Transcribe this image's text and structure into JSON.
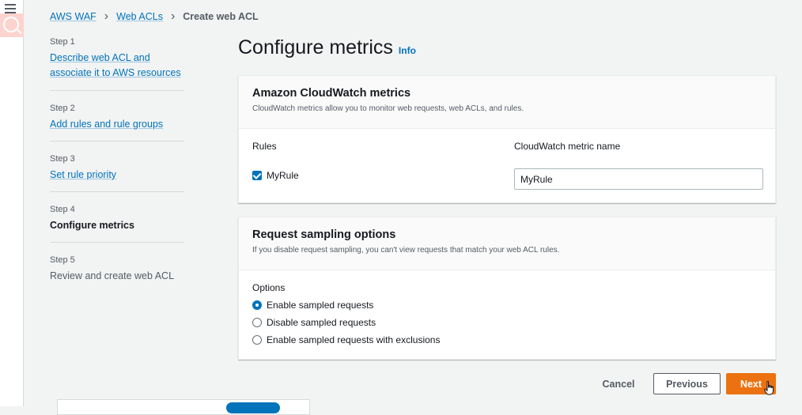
{
  "breadcrumb": {
    "items": [
      "AWS WAF",
      "Web ACLs"
    ],
    "current": "Create web ACL"
  },
  "steps": [
    {
      "label": "Step 1",
      "title_line1": "Describe web ACL and",
      "title_line2": "associate it to AWS resources",
      "state": "link"
    },
    {
      "label": "Step 2",
      "title_line1": "Add rules and rule groups",
      "state": "link"
    },
    {
      "label": "Step 3",
      "title_line1": "Set rule priority",
      "state": "link"
    },
    {
      "label": "Step 4",
      "title_line1": "Configure metrics",
      "state": "active"
    },
    {
      "label": "Step 5",
      "title_line1": "Review and create web ACL",
      "state": "disabled"
    }
  ],
  "page": {
    "title": "Configure metrics",
    "info": "Info"
  },
  "cloudwatch": {
    "title": "Amazon CloudWatch metrics",
    "description": "CloudWatch metrics allow you to monitor web requests, web ACLs, and rules.",
    "rules_header": "Rules",
    "metric_header": "CloudWatch metric name",
    "rule_name": "MyRule",
    "metric_value": "MyRule"
  },
  "sampling": {
    "title": "Request sampling options",
    "description": "If you disable request sampling, you can't view requests that match your web ACL rules.",
    "options_label": "Options",
    "options": [
      {
        "label": "Enable sampled requests",
        "checked": true
      },
      {
        "label": "Disable sampled requests",
        "checked": false
      },
      {
        "label": "Enable sampled requests with exclusions",
        "checked": false
      }
    ]
  },
  "footer": {
    "cancel": "Cancel",
    "previous": "Previous",
    "next": "Next"
  },
  "colors": {
    "primary_link": "#0073bb",
    "next_button": "#ec7211"
  },
  "icons": {
    "menu": "hamburger-menu-icon",
    "search": "search-icon",
    "breadcrumb_separator": "chevron-right-icon",
    "cursor": "hand-pointer-icon"
  }
}
